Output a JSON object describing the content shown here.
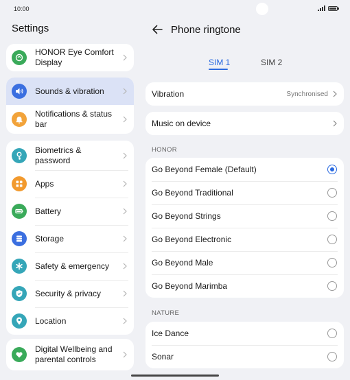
{
  "status_bar": {
    "time": "10:00"
  },
  "left_panel": {
    "title": "Settings",
    "groups": [
      {
        "items": [
          {
            "label": "HONOR Eye Comfort Display",
            "icon": "eye-comfort-icon",
            "color": "#3aaa5a",
            "active": false
          }
        ]
      },
      {
        "items": [
          {
            "label": "Sounds & vibration",
            "icon": "speaker-icon",
            "color": "#3b6fe0",
            "active": true
          },
          {
            "label": "Notifications & status bar",
            "icon": "bell-icon",
            "color": "#f2a33a",
            "active": false
          }
        ]
      },
      {
        "items": [
          {
            "label": "Biometrics & password",
            "icon": "key-icon",
            "color": "#35a6b8",
            "active": false
          },
          {
            "label": "Apps",
            "icon": "apps-grid-icon",
            "color": "#f29a2e",
            "active": false
          },
          {
            "label": "Battery",
            "icon": "battery-icon",
            "color": "#3aaa5a",
            "active": false
          },
          {
            "label": "Storage",
            "icon": "storage-icon",
            "color": "#3b6fe0",
            "active": false
          },
          {
            "label": "Safety & emergency",
            "icon": "asterisk-icon",
            "color": "#35a6b8",
            "active": false
          },
          {
            "label": "Security & privacy",
            "icon": "shield-icon",
            "color": "#35a6b8",
            "active": false
          },
          {
            "label": "Location",
            "icon": "location-pin-icon",
            "color": "#35a6b8",
            "active": false
          }
        ]
      },
      {
        "items": [
          {
            "label": "Digital Wellbeing and parental controls",
            "icon": "heart-person-icon",
            "color": "#3aaa5a",
            "active": false
          }
        ]
      }
    ]
  },
  "right_panel": {
    "title": "Phone ringtone",
    "tabs": [
      {
        "label": "SIM 1",
        "selected": true
      },
      {
        "label": "SIM 2",
        "selected": false
      }
    ],
    "vibration": {
      "label": "Vibration",
      "value": "Synchronised"
    },
    "music": {
      "label": "Music on device"
    },
    "sections": [
      {
        "header": "HONOR",
        "items": [
          {
            "label": "Go Beyond Female (Default)",
            "selected": true
          },
          {
            "label": "Go Beyond Traditional",
            "selected": false
          },
          {
            "label": "Go Beyond Strings",
            "selected": false
          },
          {
            "label": "Go Beyond Electronic",
            "selected": false
          },
          {
            "label": "Go Beyond Male",
            "selected": false
          },
          {
            "label": "Go Beyond Marimba",
            "selected": false
          }
        ]
      },
      {
        "header": "NATURE",
        "items": [
          {
            "label": "Ice Dance",
            "selected": false
          },
          {
            "label": "Sonar",
            "selected": false
          }
        ]
      }
    ]
  },
  "accent_color": "#2a6ae0"
}
